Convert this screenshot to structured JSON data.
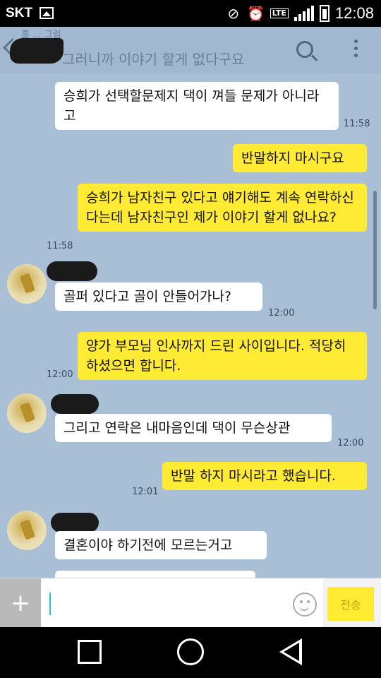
{
  "status_bar": {
    "carrier": "SKT",
    "network": "LTE",
    "time": "12:08",
    "icons": [
      "gallery-icon",
      "mute-icon",
      "alarm-icon",
      "lte-icon",
      "signal-icon",
      "battery-icon"
    ]
  },
  "header": {
    "preview_text": "그러니까 이야기 할게 없다구요",
    "subtle_text": "흠 ... 그럼",
    "icons": [
      "back-icon",
      "search-icon",
      "more-icon"
    ]
  },
  "messages": [
    {
      "side": "left",
      "text": "승희가 선택할문제지 댁이 껴들 문제가 아니라고",
      "time": "11:58"
    },
    {
      "side": "right",
      "text": "반말하지 마시구요",
      "time": ""
    },
    {
      "side": "right",
      "text": "승희가 남자친구 있다고 얘기해도 계속 연락하신다는데 남자친구인 제가 이야기 할게 없나요?",
      "time": "11:58"
    },
    {
      "side": "left",
      "text": "골퍼 있다고 골이 안들어가나?",
      "time": "12:00"
    },
    {
      "side": "right",
      "text": "양가 부모님 인사까지 드린 사이입니다. 적당히 하셨으면 합니다.",
      "time": "12:00"
    },
    {
      "side": "left",
      "text": "그리고 연락은 내마음인데 댁이 무슨상관",
      "time": "12:00"
    },
    {
      "side": "right",
      "text": "반말 하지 마시라고 했습니다.",
      "time": "12:01"
    },
    {
      "side": "left",
      "text": "결혼이야 하기전에 모르는거고",
      "time": ""
    }
  ],
  "input_bar": {
    "send_label": "전송",
    "icons": [
      "plus-icon",
      "emoji-icon"
    ]
  },
  "colors": {
    "chat_background": "#a9bfd6",
    "my_bubble": "#ffeb33",
    "their_bubble": "#ffffff"
  }
}
